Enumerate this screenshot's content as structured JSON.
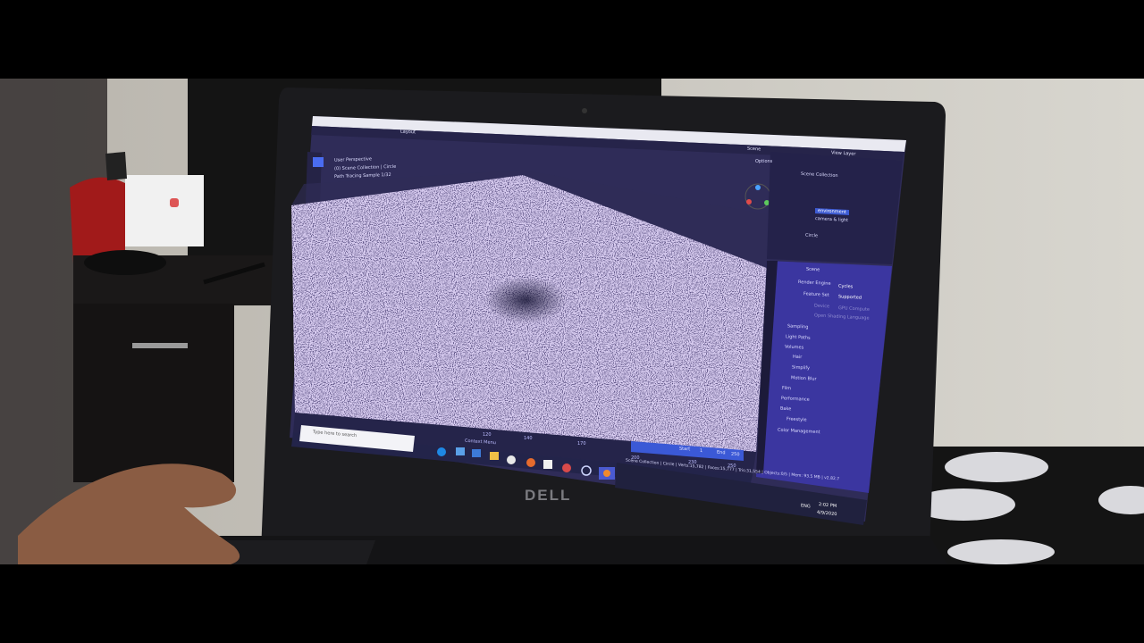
{
  "photo": {
    "laptop_brand": "DELL",
    "colors": {
      "letterbox": "#000000",
      "wall": "#c9c6bd",
      "laptop_body": "#1b1b1e",
      "screen_ui": "#2f2c58",
      "viewport_noise": "#d9cdf1",
      "taskbar": "#23244a"
    }
  },
  "blender": {
    "header_tabs": [
      "Layout"
    ],
    "outliner": {
      "title": "Scene Collection",
      "items": [
        "environment",
        "camera & light",
        "Circle"
      ],
      "view_layer": "View Layer",
      "scene": "Scene"
    },
    "properties": {
      "context": "Scene",
      "render_engine_label": "Render Engine",
      "render_engine_value": "Cycles",
      "feature_set_label": "Feature Set",
      "feature_set_value": "Supported",
      "device_label": "Device",
      "device_value": "GPU Compute",
      "osl_label": "Open Shading Language",
      "panels": [
        "Sampling",
        "Light Paths",
        "Volumes",
        "Hair",
        "Simplify",
        "Motion Blur",
        "Film",
        "Performance",
        "Bake",
        "Freestyle",
        "Color Management"
      ]
    },
    "viewport": {
      "perspective": "User Perspective",
      "collection_path": "(0) Scene Collection | Circle",
      "status": "Path Tracing Sample 1/32",
      "options": "Options"
    },
    "timeline": {
      "start_label": "Start",
      "start_value": "1",
      "end_label": "End",
      "end_value": "250",
      "frame_ticks": [
        "120",
        "130",
        "140",
        "150",
        "160",
        "170",
        "180",
        "190",
        "200",
        "210",
        "220",
        "230",
        "240",
        "250"
      ]
    },
    "status_bar": "Scene Collection | Circle | Verts:15,782 | Faces:15,777 | Tris:31,554 | Objects:0/5 | Mem: 93.5 MB | v2.82.7"
  },
  "windows": {
    "search_placeholder": "Type here to search",
    "context_menu": "Context Menu",
    "language": "ENG",
    "time": "2:02 PM",
    "date": "4/9/2020"
  }
}
